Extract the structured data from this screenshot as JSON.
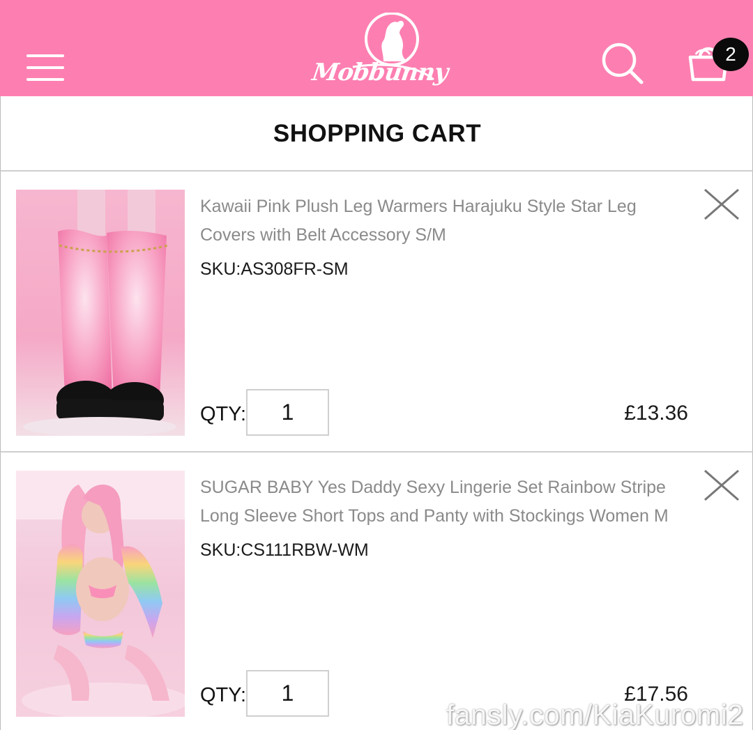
{
  "header": {
    "brand": "Mobbunny",
    "cart_count": "2",
    "colors": {
      "bar": "#fd7fb1",
      "icons": "#ffffff",
      "badge": "#0a0a0a"
    },
    "icons": {
      "menu": "hamburger-menu-icon",
      "search": "search-icon",
      "cart": "shopping-bag-icon"
    }
  },
  "page": {
    "title": "SHOPPING CART"
  },
  "cart": {
    "qty_label": "QTY:",
    "sku_label": "SKU:",
    "items": [
      {
        "name": "Kawaii Pink Plush Leg Warmers Harajuku Style Star Leg Covers with Belt Accessory S/M",
        "sku": "AS308FR-SM",
        "qty": "1",
        "price": "£13.36"
      },
      {
        "name": "SUGAR BABY Yes Daddy Sexy Lingerie Set Rainbow Stripe Long Sleeve Short Tops and Panty with Stockings Women M",
        "sku": "CS111RBW-WM",
        "qty": "1",
        "price": "£17.56"
      }
    ]
  },
  "watermark": "fansly.com/KiaKuromi2"
}
